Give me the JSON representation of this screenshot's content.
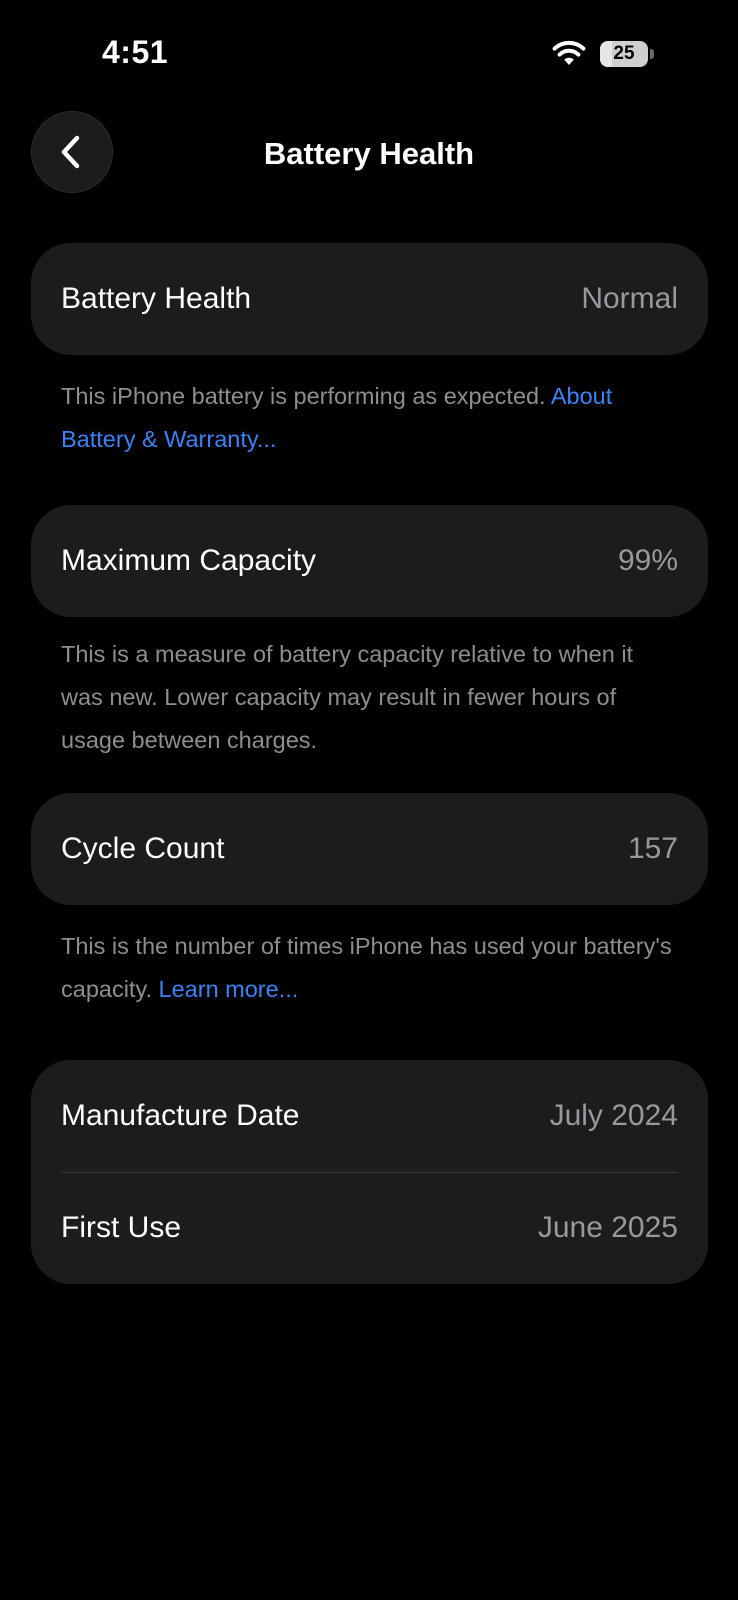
{
  "status_bar": {
    "time": "4:51",
    "wifi_icon": "wifi-icon",
    "battery_level": 25,
    "battery_label": "25"
  },
  "nav": {
    "back_icon": "chevron-left-icon",
    "title": "Battery Health"
  },
  "battery_health": {
    "label": "Battery Health",
    "value": "Normal",
    "footnote": "This iPhone battery is performing as expected. ",
    "link": "About Battery & Warranty..."
  },
  "maximum_capacity": {
    "label": "Maximum Capacity",
    "value": "99%",
    "footnote": "This is a measure of battery capacity relative to when it was new. Lower capacity may result in fewer hours of usage between charges."
  },
  "cycle_count": {
    "label": "Cycle Count",
    "value": "157",
    "footnote": "This is the number of times iPhone has used your battery's capacity. ",
    "link": "Learn more..."
  },
  "dates": {
    "manufacture_label": "Manufacture Date",
    "manufacture_value": "July 2024",
    "first_use_label": "First Use",
    "first_use_value": "June 2025"
  },
  "colors": {
    "background": "#000000",
    "card": "#1c1c1e",
    "secondary_text": "#98989e",
    "link": "#3b82f6"
  }
}
